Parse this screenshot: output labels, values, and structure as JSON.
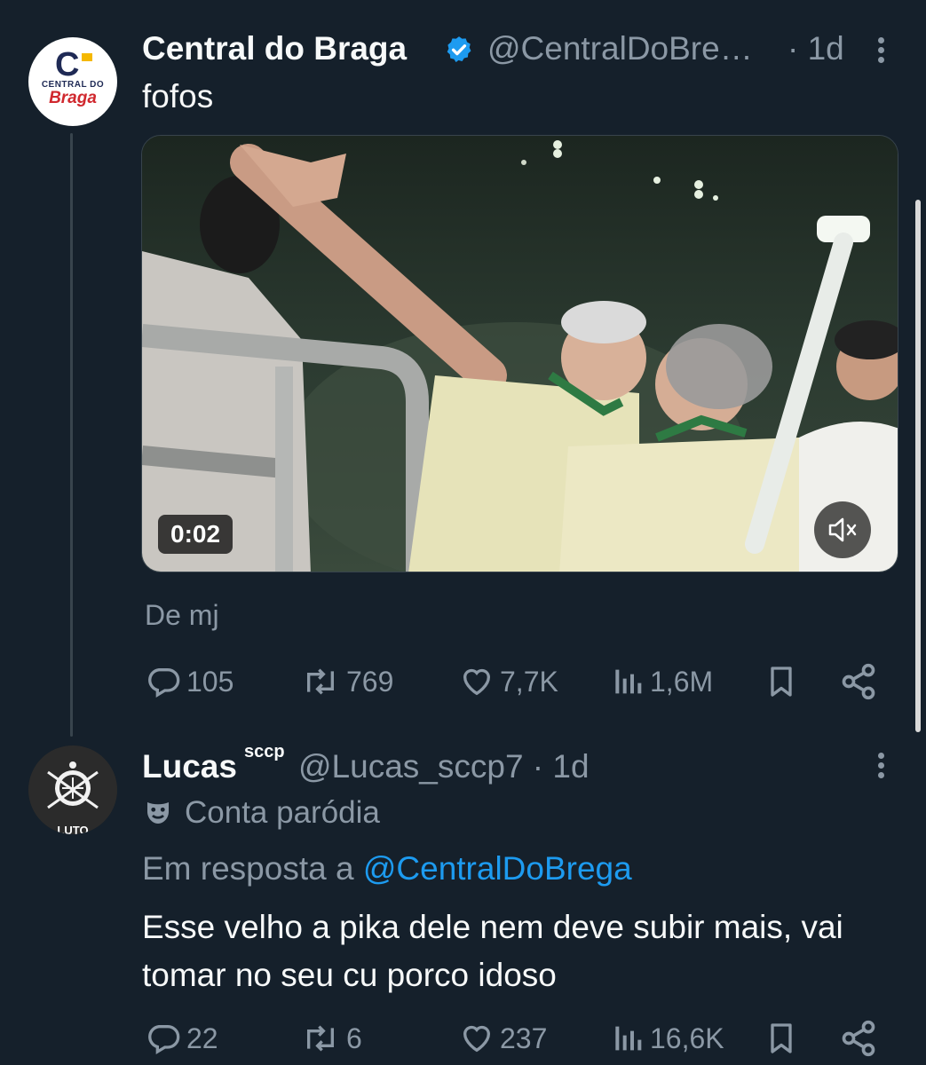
{
  "tweet1": {
    "display_name": "Central do Braga",
    "handle": "@CentralDoBre…",
    "time": "· 1d",
    "text": "fofos",
    "avatar": {
      "line1": "CENTRAL DO",
      "line2": "Braga"
    },
    "media": {
      "duration": "0:02",
      "mute_icon": "muted-speaker-icon"
    },
    "from_label": "De mj",
    "actions": {
      "replies": "105",
      "reposts": "769",
      "likes": "7,7K",
      "views": "1,6M"
    }
  },
  "tweet2": {
    "display_name": "Lucas",
    "name_superscript": "sccp",
    "handle": "@Lucas_sccp7 · 1d",
    "parody_label": "Conta paródia",
    "reply_prefix": "Em resposta a ",
    "reply_mention": "@CentralDoBrega",
    "text": "Esse velho a pika dele nem deve subir mais, vai tomar no seu cu porco idoso",
    "avatar_label": "LUTO",
    "actions": {
      "replies": "22",
      "reposts": "6",
      "likes": "237",
      "views": "16,6K"
    }
  },
  "colors": {
    "background": "#15202b",
    "text_primary": "#f7f9f9",
    "text_secondary": "#8b98a5",
    "link": "#1d9bf0",
    "verified": "#1d9bf0"
  }
}
